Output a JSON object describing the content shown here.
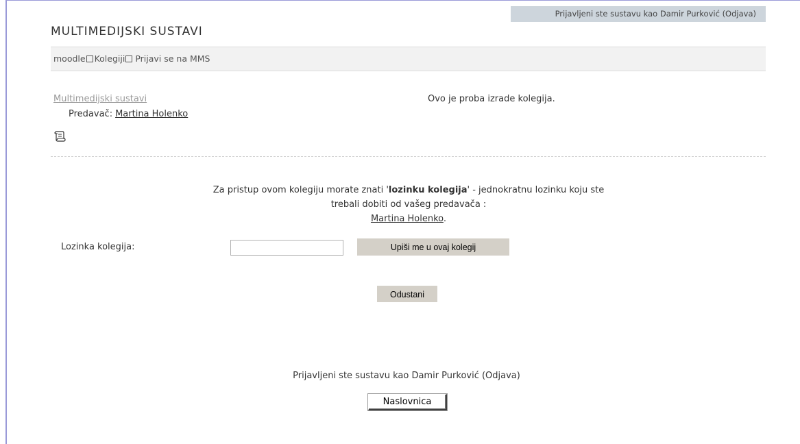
{
  "header": {
    "login_info": "Prijavljeni ste sustavu kao Damir Purković (Odjava)",
    "site_title": "MULTIMEDIJSKI SUSTAVI"
  },
  "navbar": {
    "items": [
      "moodle",
      "Kolegiji",
      "Prijavi se na MMS"
    ]
  },
  "course": {
    "name": "Multimedijski sustavi",
    "teacher_label": "Predavač:",
    "teacher_name": "Martina Holenko",
    "summary": "Ovo je proba izrade kolegija.",
    "info_icon": "info-icon"
  },
  "enrol": {
    "notice_part1": "Za pristup ovom kolegiju morate znati '",
    "notice_bold": "lozinku kolegija",
    "notice_part2": "' - jednokratnu lozinku koju ste trebali dobiti od vašeg predavača :",
    "notice_teacher": "Martina Holenko",
    "notice_end": ".",
    "password_label": "Lozinka kolegija:",
    "password_value": "",
    "enrol_button": "Upiši me u ovaj kolegij",
    "cancel_button": "Odustani"
  },
  "footer": {
    "login_info": "Prijavljeni ste sustavu kao Damir Purković (Odjava)",
    "home_button": "Naslovnica"
  }
}
